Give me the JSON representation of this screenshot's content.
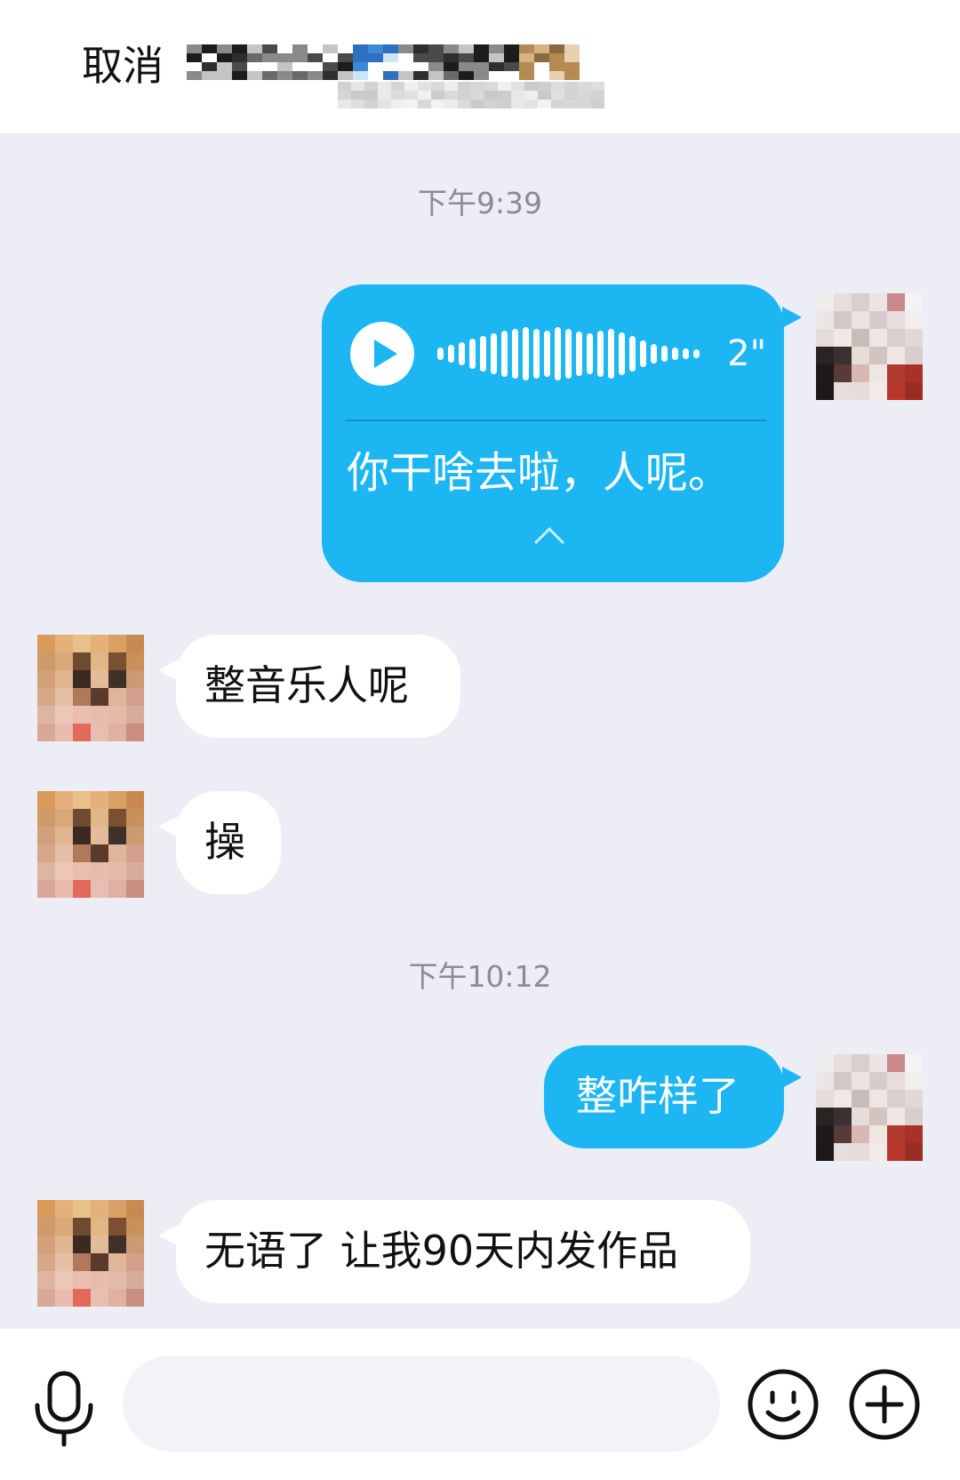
{
  "header": {
    "cancel_label": "取消"
  },
  "conversation": {
    "messages": [
      {
        "kind": "timestamp",
        "text": "下午9:39"
      },
      {
        "kind": "voice",
        "direction": "outgoing",
        "duration": "2\"",
        "transcript": "你干啥去啦，人呢。"
      },
      {
        "kind": "text",
        "direction": "incoming",
        "text": "整音乐人呢"
      },
      {
        "kind": "text",
        "direction": "incoming",
        "text": "操"
      },
      {
        "kind": "timestamp",
        "text": "下午10:12"
      },
      {
        "kind": "text",
        "direction": "outgoing",
        "text": "整咋样了"
      },
      {
        "kind": "text",
        "direction": "incoming",
        "text": "无语了 让我90天内发作品"
      }
    ]
  },
  "input_bar": {
    "placeholder": "",
    "icons": [
      "microphone-icon",
      "emoji-icon",
      "plus-icon"
    ]
  },
  "colors": {
    "outgoing_bubble": "#1cb6f2",
    "incoming_bubble": "#ffffff",
    "chat_background": "#ededf5",
    "timestamp_text": "#8b8b93"
  }
}
